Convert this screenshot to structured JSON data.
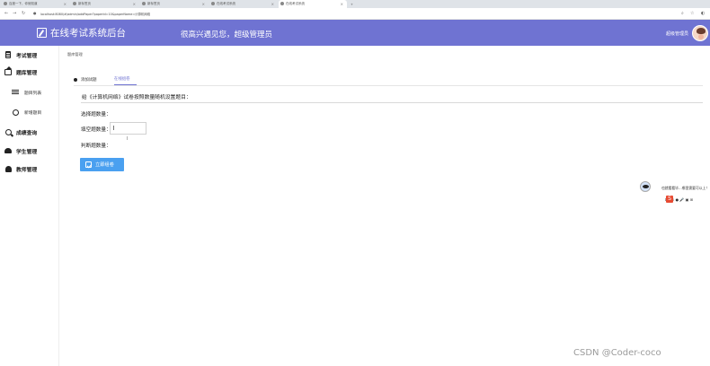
{
  "browser": {
    "tabs": [
      {
        "label": "百度一下，你就知道",
        "active": false
      },
      {
        "label": "新标签页",
        "active": false
      },
      {
        "label": "新标签页",
        "active": false
      },
      {
        "label": "在线考试系统",
        "active": false
      },
      {
        "label": "在线考试系统",
        "active": true
      }
    ],
    "url": "localhost:8080/#/admin/addPaper?paperId=10&paperName=计算机网络"
  },
  "header": {
    "brand": "在线考试系统后台",
    "welcome": "很高兴遇见您，超级管理员",
    "user": "超级管理员"
  },
  "sidebar": {
    "items": [
      {
        "label": "考试管理",
        "icon": "document-icon"
      },
      {
        "label": "题库管理",
        "icon": "bank-icon"
      },
      {
        "label": "题目列表",
        "icon": "list-icon"
      },
      {
        "label": "新增题目",
        "icon": "new-icon"
      },
      {
        "label": "成绩查询",
        "icon": "query-icon"
      },
      {
        "label": "学生管理",
        "icon": "student-icon"
      },
      {
        "label": "教师管理",
        "icon": "teacher-icon"
      }
    ]
  },
  "breadcrumb": "题库管理",
  "page_tabs": [
    {
      "label": "添加试题",
      "active": false
    },
    {
      "label": "在线组卷",
      "active": true
    }
  ],
  "form": {
    "question": "给《计算机网络》试卷按照数量随机设置题目：",
    "choice_label": "选择题数量：",
    "blank_label": "填空题数量：",
    "judge_label": "判断题数量：",
    "blank_value": "",
    "create_button": "立即组卷"
  },
  "widget": {
    "bubble": "也就看看毕…哪里需要可以上！"
  },
  "watermark": "CSDN @Coder-coco",
  "colors": {
    "header_bg": "#6f73d2",
    "button_bg": "#4aa0f0"
  }
}
